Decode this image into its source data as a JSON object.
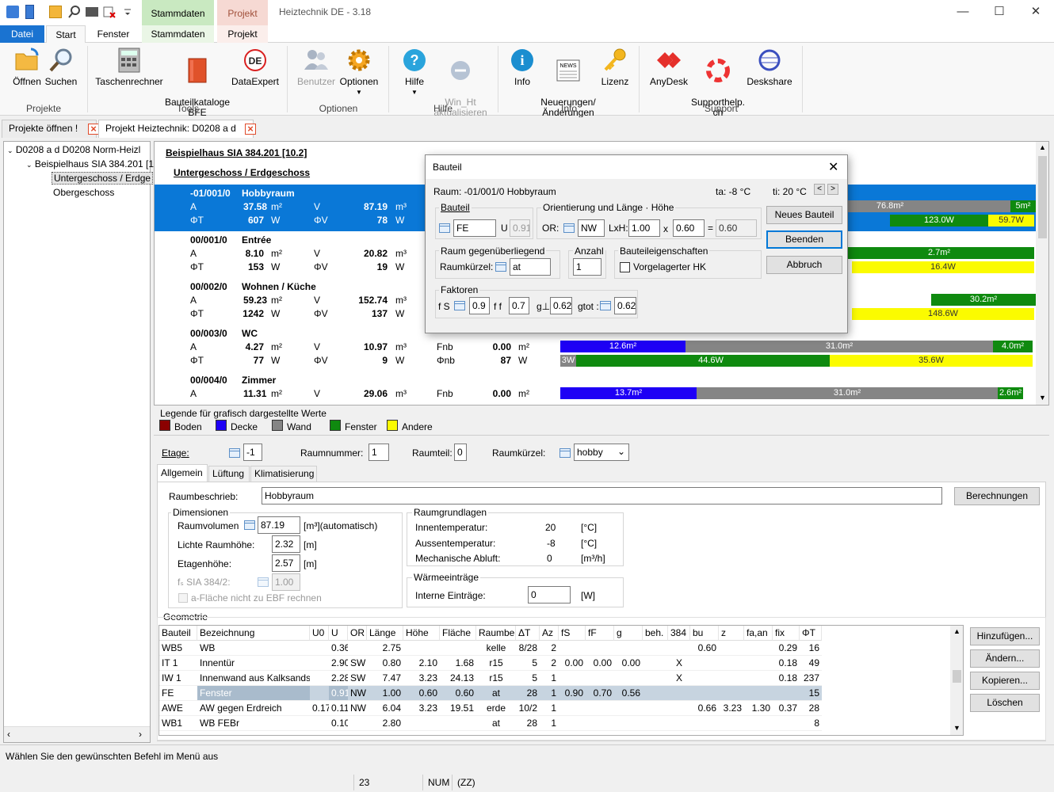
{
  "app": {
    "title": "Heiztechnik DE - 3.18"
  },
  "context_tabs": {
    "stammdaten": "Stammdaten",
    "projekt": "Projekt"
  },
  "ribbon_tabs": [
    "Datei",
    "Start",
    "Fenster",
    "Stammdaten",
    "Projekt"
  ],
  "ribbon": {
    "buttons": {
      "oeffnen": "Öffnen",
      "suchen": "Suchen",
      "taschenrechner": "Taschenrechner",
      "bauteilkataloge": "Bauteilkataloge\nBFE",
      "dataexpert": "DataExpert",
      "benutzer": "Benutzer",
      "optionen": "Optionen",
      "hilfe": "Hilfe",
      "winht": "Win_Ht\naktualisieren",
      "info": "Info",
      "neuerungen": "Neuerungen/\nÄnderungen",
      "lizenz": "Lizenz",
      "anydesk": "AnyDesk",
      "supporthelp": "Supporthelp.\nch",
      "deskshare": "Deskshare"
    },
    "groups": {
      "projekte": "Projekte",
      "tools": "Tools",
      "optionen": "Optionen",
      "hilfe": "Hilfe",
      "info": "Info",
      "support": "Support"
    },
    "icons": {
      "de_badge": "DE",
      "news_badge": "NEWS"
    }
  },
  "doc_tabs": [
    {
      "label": "Projekte öffnen !"
    },
    {
      "label": "Projekt Heiztechnik: D0208 a d"
    }
  ],
  "tree": {
    "items": [
      "D0208 a d   D0208 Norm-Heizl",
      "Beispielhaus SIA 384.201 [1",
      "Untergeschoss / Erdge",
      "Obergeschoss"
    ]
  },
  "roomlist": {
    "title": "Beispielhaus SIA 384.201 [10.2]",
    "floor": "Untergeschoss / Erdgeschoss",
    "rooms": [
      {
        "id": "-01/001/0",
        "name": "Hobbyraum",
        "A": "37.58",
        "V": "87.19",
        "phiT": "607",
        "phiV": "78",
        "bars1": [
          "76.8m²",
          "5m²"
        ],
        "bars2": [
          "123.0W",
          "59.7W"
        ]
      },
      {
        "id": "00/001/0",
        "name": "Entrée",
        "A": "8.10",
        "V": "20.82",
        "phiT": "153",
        "phiV": "19",
        "bars1": [
          "2.7m²"
        ],
        "bars2": [
          "16.4W"
        ]
      },
      {
        "id": "00/002/0",
        "name": "Wohnen / Küche",
        "A": "59.23",
        "V": "152.74",
        "phiT": "1242",
        "phiV": "137",
        "bars1": [
          "30.2m²"
        ],
        "bars2": [
          "148.6W"
        ]
      },
      {
        "id": "00/003/0",
        "name": "WC",
        "A": "4.27",
        "V": "10.97",
        "phiT": "77",
        "phiV": "9",
        "fnb": "0.00",
        "phinb": "87",
        "bars1": [
          "12.6m²",
          "31.0m²",
          "4.0m²"
        ],
        "bars2": [
          "3W",
          "44.6W",
          "35.6W"
        ]
      },
      {
        "id": "00/004/0",
        "name": "Zimmer",
        "A": "11.31",
        "V": "29.06",
        "fnb": "0.00",
        "bars1": [
          "13.7m²",
          "31.0m²",
          "2.6m²"
        ]
      }
    ],
    "labels": {
      "A": "A",
      "V": "V",
      "phiT": "ΦT",
      "phiV": "ΦV",
      "m2": "m²",
      "m3": "m³",
      "W": "W",
      "fnb": "Fnb",
      "phinb": "Φnb"
    }
  },
  "legend": {
    "title": "Legende für grafisch dargestellte Werte",
    "items": [
      {
        "label": "Boden",
        "color": "#8b0000"
      },
      {
        "label": "Decke",
        "color": "#1e00f5"
      },
      {
        "label": "Wand",
        "color": "#858585"
      },
      {
        "label": "Fenster",
        "color": "#0f8a0f"
      },
      {
        "label": "Andere",
        "color": "#fbfb00"
      }
    ]
  },
  "form": {
    "etage_label": "Etage:",
    "etage": "-1",
    "raumnummer_label": "Raumnummer:",
    "raumnummer": "1",
    "raumteil_label": "Raumteil:",
    "raumteil": "0",
    "raumkuerzel_label": "Raumkürzel:",
    "raumkuerzel": "hobby",
    "tabs": [
      "Allgemein",
      "Lüftung",
      "Klimatisierung"
    ],
    "raumbeschrieb_label": "Raumbeschrieb:",
    "raumbeschrieb": "Hobbyraum",
    "berechnungen": "Berechnungen",
    "dim_title": "Dimensionen",
    "raumvolumen_label": "Raumvolumen",
    "raumvolumen": "87.19",
    "raumvolumen_unit": "[m³](automatisch)",
    "lichte_label": "Lichte Raumhöhe:",
    "lichte": "2.32",
    "etagen_label": "Etagenhöhe:",
    "etagen": "2.57",
    "unit_m": "[m]",
    "fs_label": "fₛ SIA 384/2:",
    "fs": "1.00",
    "aflaeche": "a-Fläche nicht zu EBF rechnen",
    "rg_title": "Raumgrundlagen",
    "innen_label": "Innentemperatur:",
    "innen": "20",
    "aussen_label": "Aussentemperatur:",
    "aussen": "-8",
    "unit_c": "[°C]",
    "abluft_label": "Mechanische Abluft:",
    "abluft": "0",
    "unit_m3h": "[m³/h]",
    "we_title": "Wärmeeinträge",
    "interne_label": "Interne Einträge:",
    "interne": "0",
    "unit_w": "[W]",
    "geom_title": "Geometrie",
    "geom_buttons": [
      "Hinzufügen...",
      "Ändern...",
      "Kopieren...",
      "Löschen"
    ]
  },
  "grid": {
    "headers": [
      "Bauteil",
      "Bezeichnung",
      "U0",
      "U",
      "OR",
      "Länge",
      "Höhe",
      "Fläche",
      "Raumbe.",
      "ΔT",
      "Az",
      "fS",
      "fF",
      "g",
      "beh.",
      "384",
      "bu",
      "z",
      "fa,an",
      "fix",
      "ΦT"
    ],
    "rows": [
      [
        "WB5",
        "WB",
        "",
        "0.36",
        "",
        "2.75",
        "",
        "",
        "kelle",
        "8/28",
        "2",
        "",
        "",
        "",
        "",
        "",
        "0.60",
        "",
        "",
        "0.29",
        "16"
      ],
      [
        "IT 1",
        "Innentür",
        "",
        "2.90",
        "SW",
        "0.80",
        "2.10",
        "1.68",
        "r15",
        "5",
        "2",
        "0.00",
        "0.00",
        "0.00",
        "",
        "X",
        "",
        "",
        "",
        "0.18",
        "49"
      ],
      [
        "IW 1",
        "Innenwand aus Kalksandst",
        "",
        "2.28",
        "SW",
        "7.47",
        "3.23",
        "24.13",
        "r15",
        "5",
        "1",
        "",
        "",
        "",
        "",
        "X",
        "",
        "",
        "",
        "0.18",
        "237"
      ],
      [
        "FE",
        "Fenster",
        "",
        "0.91",
        "NW",
        "1.00",
        "0.60",
        "0.60",
        "at",
        "28",
        "1",
        "0.90",
        "0.70",
        "0.56",
        "",
        "",
        "",
        "",
        "",
        "",
        "15"
      ],
      [
        "AWE",
        "AW gegen Erdreich",
        "0.17",
        "0.11/",
        "NW",
        "6.04",
        "3.23",
        "19.51",
        "erde",
        "10/2",
        "1",
        "",
        "",
        "",
        "",
        "",
        "0.66",
        "3.23",
        "1.30",
        "0.37",
        "28"
      ],
      [
        "WB1",
        "WB FEBr",
        "",
        "0.10",
        "",
        "2.80",
        "",
        "",
        "at",
        "28",
        "1",
        "",
        "",
        "",
        "",
        "",
        "",
        "",
        "",
        "",
        "8"
      ]
    ]
  },
  "dialog": {
    "title": "Bauteil",
    "raum": "Raum: -01/001/0  Hobbyraum",
    "ta": "ta:  -8 °C",
    "ti": "ti: 20 °C",
    "bauteil_title": "Bauteil",
    "bauteil": "FE",
    "u_label": "U",
    "u": "0.91",
    "ori_title": "Orientierung und Länge · Höhe",
    "or_label": "OR:",
    "or": "NW",
    "lxh_label": "LxH:",
    "l": "1.00",
    "x": "x",
    "h": "0.60",
    "eq": "=",
    "area": "0.60",
    "rg_title": "Raum gegenüberliegend",
    "rk_label": "Raumkürzel:",
    "rk": "at",
    "anzahl_title": "Anzahl",
    "anzahl": "1",
    "be_title": "Bauteileigenschaften",
    "vorgelagert": "Vorgelagerter HK",
    "faktoren_title": "Faktoren",
    "fs_label": "f S",
    "fs": "0.9",
    "ff_label": "f f",
    "ff": "0.7",
    "g_label": "g⊥:",
    "g": "0.62",
    "gtot_label": "gtot :",
    "gtot": "0.62",
    "btn_neu": "Neues Bauteil",
    "btn_beenden": "Beenden",
    "btn_abbruch": "Abbruch"
  },
  "status": {
    "message": "Wählen Sie den gewünschten Befehl im Menü aus",
    "num23": "23",
    "num": "NUM",
    "zz": "(ZZ)"
  }
}
